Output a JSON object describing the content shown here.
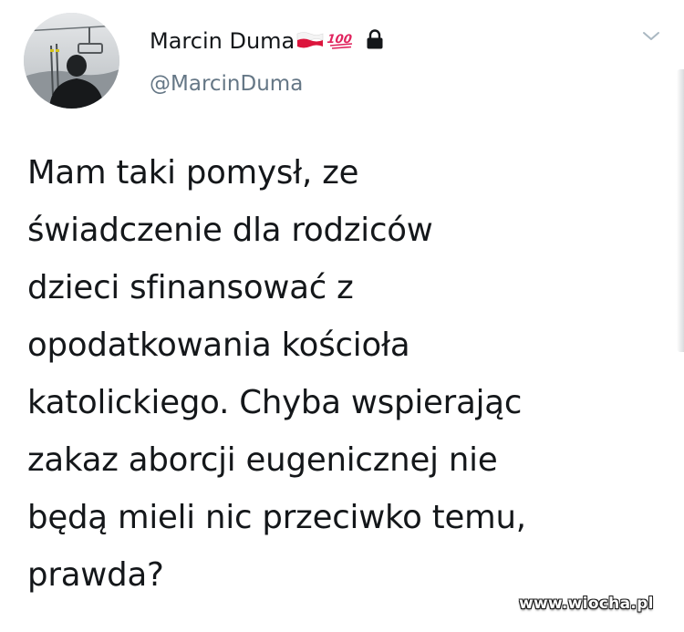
{
  "tweet": {
    "author": {
      "display_name": "Marcin Duma",
      "handle": "@MarcinDuma",
      "badges": [
        "poland-flag-icon",
        "hundred-points-icon",
        "lock-icon"
      ],
      "avatar": "ski-lift-photo-avatar"
    },
    "menu_icon": "chevron-down-icon",
    "text_lines": [
      "Mam taki pomysł, ze",
      "świadczenie dla rodziców",
      "dzieci sfinansować z",
      "opodatkowania kościoła",
      "katolickiego. Chyba wspierając",
      "zakaz aborcji eugenicznej nie",
      "będą mieli nic przeciwko temu,",
      "prawda?"
    ]
  },
  "watermark": "www.wiocha.pl",
  "colors": {
    "text": "#14171a",
    "handle": "#657786",
    "chevron": "#aab8c2",
    "background": "#ffffff"
  }
}
